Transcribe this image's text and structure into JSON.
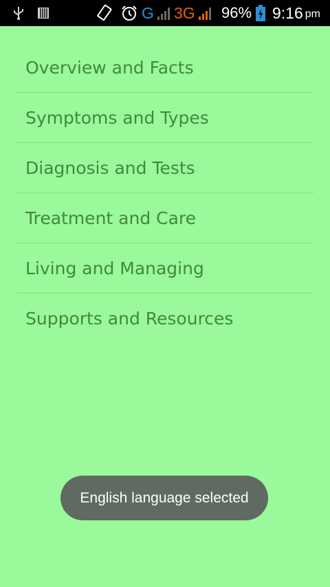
{
  "status_bar": {
    "icons": [
      "usb-icon",
      "sd-card-icon",
      "rotate-icon",
      "alarm-icon",
      "signal-icon",
      "signal-icon",
      "battery-charging-icon"
    ],
    "network_1": "G",
    "network_2": "3G",
    "battery": "96%",
    "time": "9:16",
    "ampm": "pm",
    "colors": {
      "network_1": "#2c8fd6",
      "network_2": "#e8600e",
      "battery": "#2c8fd6"
    }
  },
  "menu": {
    "items": [
      {
        "label": "Overview and Facts"
      },
      {
        "label": "Symptoms and Types"
      },
      {
        "label": "Diagnosis and Tests"
      },
      {
        "label": "Treatment and Care"
      },
      {
        "label": "Living and Managing"
      },
      {
        "label": "Supports and Resources"
      }
    ]
  },
  "toast": {
    "message": "English language selected"
  },
  "colors": {
    "background": "#9af99a",
    "menu_text": "#3f8a3f",
    "toast_bg": "#5f6a61"
  }
}
